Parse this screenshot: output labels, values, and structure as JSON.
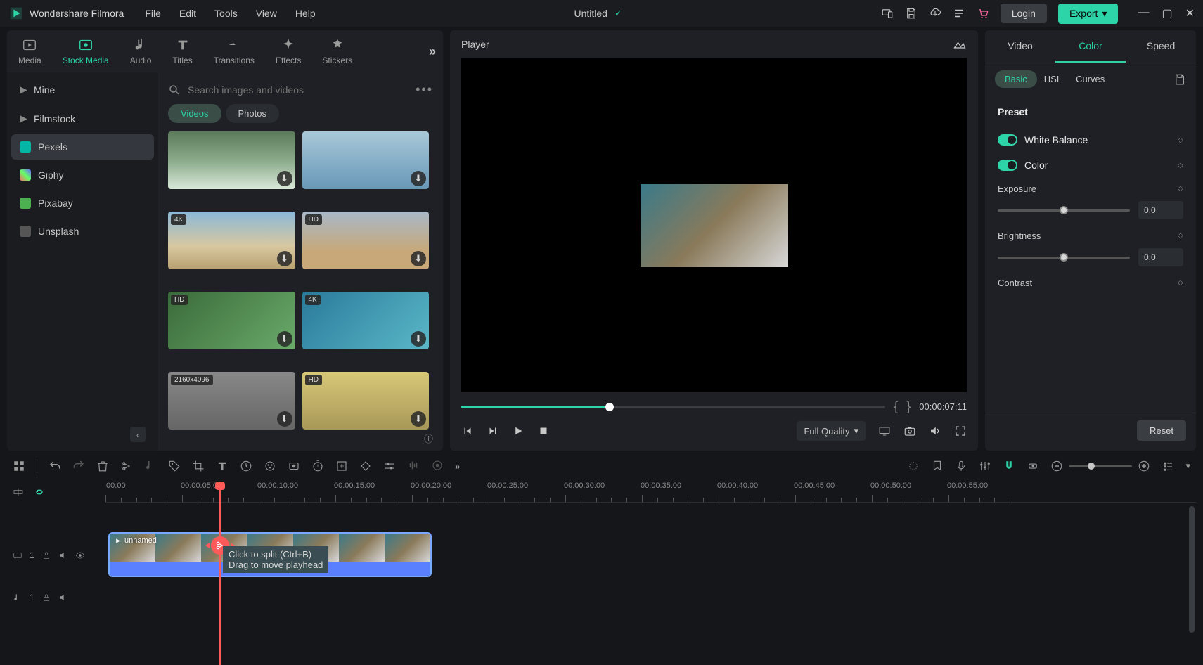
{
  "app": {
    "brand": "Wondershare Filmora",
    "doc_title": "Untitled"
  },
  "menu": [
    "File",
    "Edit",
    "Tools",
    "View",
    "Help"
  ],
  "header_buttons": {
    "login": "Login",
    "export": "Export"
  },
  "top_tabs": [
    {
      "label": "Media"
    },
    {
      "label": "Stock Media"
    },
    {
      "label": "Audio"
    },
    {
      "label": "Titles"
    },
    {
      "label": "Transitions"
    },
    {
      "label": "Effects"
    },
    {
      "label": "Stickers"
    }
  ],
  "sidebar": {
    "items": [
      {
        "label": "Mine",
        "arrow": true
      },
      {
        "label": "Filmstock",
        "arrow": true
      },
      {
        "label": "Pexels",
        "color": "#06b6a4"
      },
      {
        "label": "Giphy",
        "color": "linear"
      },
      {
        "label": "Pixabay",
        "color": "#4caf50"
      },
      {
        "label": "Unsplash",
        "color": "#666"
      }
    ]
  },
  "search": {
    "placeholder": "Search images and videos"
  },
  "filter_pills": [
    "Videos",
    "Photos"
  ],
  "thumbs": [
    {
      "badge": "",
      "cls": "grad-waterfall"
    },
    {
      "badge": "",
      "cls": "grad-waves"
    },
    {
      "badge": "4K",
      "cls": "grad-beach"
    },
    {
      "badge": "HD",
      "cls": "grad-van"
    },
    {
      "badge": "HD",
      "cls": "grad-plant"
    },
    {
      "badge": "4K",
      "cls": "grad-aerial"
    },
    {
      "badge": "2160x4096",
      "cls": "grad-people"
    },
    {
      "badge": "HD",
      "cls": "grad-sunset"
    }
  ],
  "player": {
    "title": "Player",
    "timecode": "00:00:07:11",
    "quality": "Full Quality"
  },
  "right_panel": {
    "tabs": [
      "Video",
      "Color",
      "Speed"
    ],
    "subtabs": [
      "Basic",
      "HSL",
      "Curves"
    ],
    "preset_label": "Preset",
    "toggles": [
      {
        "label": "White Balance"
      },
      {
        "label": "Color"
      }
    ],
    "props": [
      {
        "label": "Exposure",
        "value": "0,0"
      },
      {
        "label": "Brightness",
        "value": "0,0"
      },
      {
        "label": "Contrast",
        "value": ""
      }
    ],
    "reset": "Reset"
  },
  "timeline": {
    "marks": [
      ":00:00",
      "00:00:05:00",
      "00:00:10:00",
      "00:00:15:00",
      "00:00:20:00",
      "00:00:25:00",
      "00:00:30:00",
      "00:00:35:00",
      "00:00:40:00",
      "00:00:45:00",
      "00:00:50:00",
      "00:00:55:00"
    ],
    "clip_label": "unnamed",
    "tooltip_line1": "Click to split (Ctrl+B)",
    "tooltip_line2": "Drag to move playhead",
    "video_track_num": "1",
    "audio_track_num": "1"
  }
}
